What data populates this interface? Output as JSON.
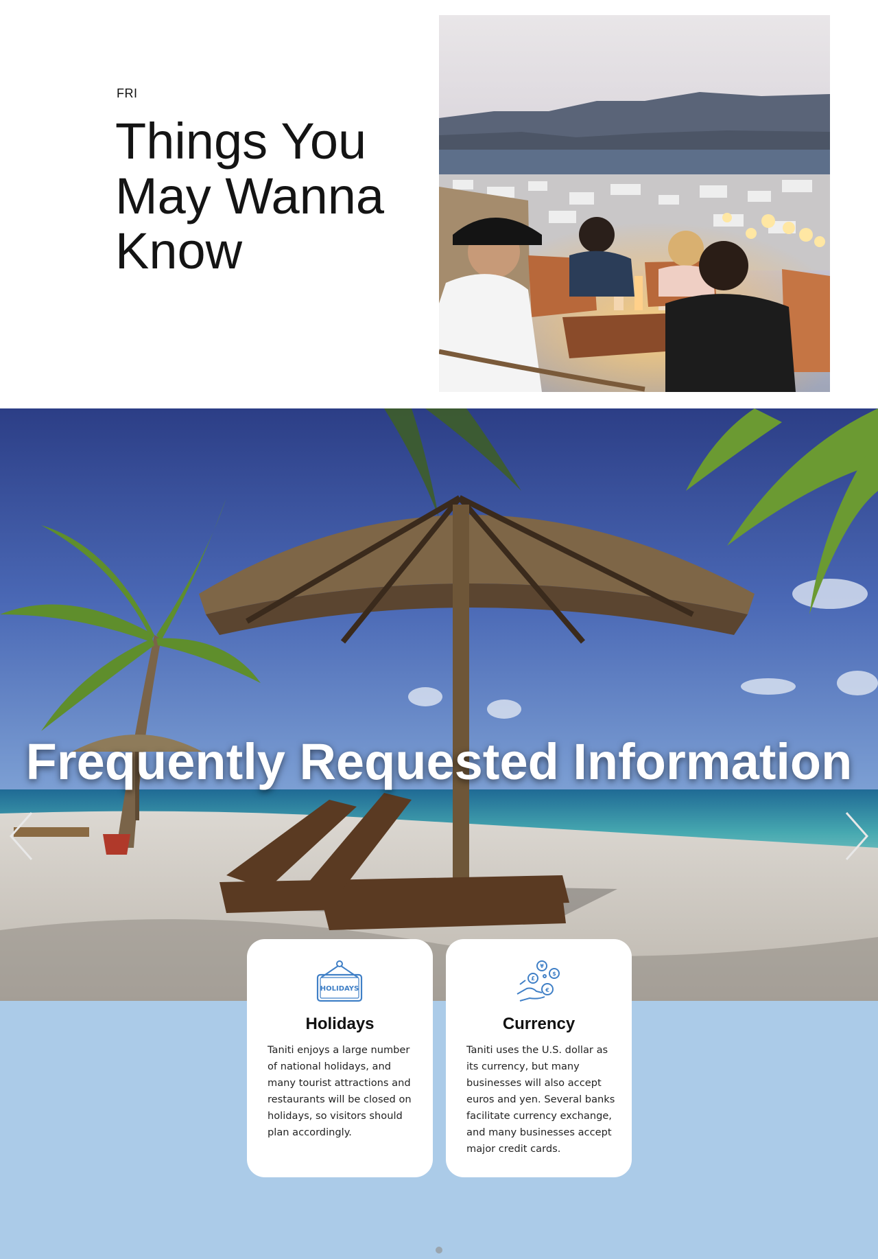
{
  "intro": {
    "eyebrow": "FRI",
    "headline": "Things You May Wanna Know",
    "photo_alt": "People dining on a terrace overlooking a seaside town at dusk"
  },
  "hero": {
    "title": "Frequently Requested Information",
    "prev_icon": "chevron-left-icon",
    "next_icon": "chevron-right-icon"
  },
  "cards": [
    {
      "icon": "holidays-sign-icon",
      "icon_label": "HOLIDAYS",
      "title": "Holidays",
      "text": "Taniti enjoys a large number of national holidays, and many tourist attractions and restaurants will be closed on holidays, so visitors should plan accordingly."
    },
    {
      "icon": "currency-hand-icon",
      "title": "Currency",
      "text": "Taniti uses the U.S. dollar as its currency, but many businesses will also accept euros and yen. Several banks facilitate currency exchange, and many businesses accept major credit cards."
    }
  ],
  "colors": {
    "info_background": "#abcbe8",
    "icon_blue": "#3f7fc6",
    "card_background": "#ffffff"
  }
}
